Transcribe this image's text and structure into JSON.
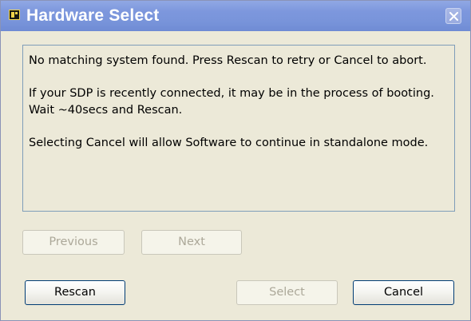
{
  "window": {
    "title": "Hardware Select",
    "icon": "labview-app-icon",
    "close_icon": "close-icon"
  },
  "message": {
    "paragraphs": [
      "No matching system found. Press Rescan to retry or Cancel to abort.",
      "If your SDP is recently connected, it may be in the process of booting. Wait ~40secs and Rescan.",
      "Selecting Cancel will allow Software to continue in standalone mode."
    ]
  },
  "buttons": {
    "previous": "Previous",
    "next": "Next",
    "rescan": "Rescan",
    "select": "Select",
    "cancel": "Cancel"
  },
  "colors": {
    "titlebar": "#7d97dd",
    "dialog_background": "#ece9d8",
    "disabled_text": "#aca899"
  }
}
